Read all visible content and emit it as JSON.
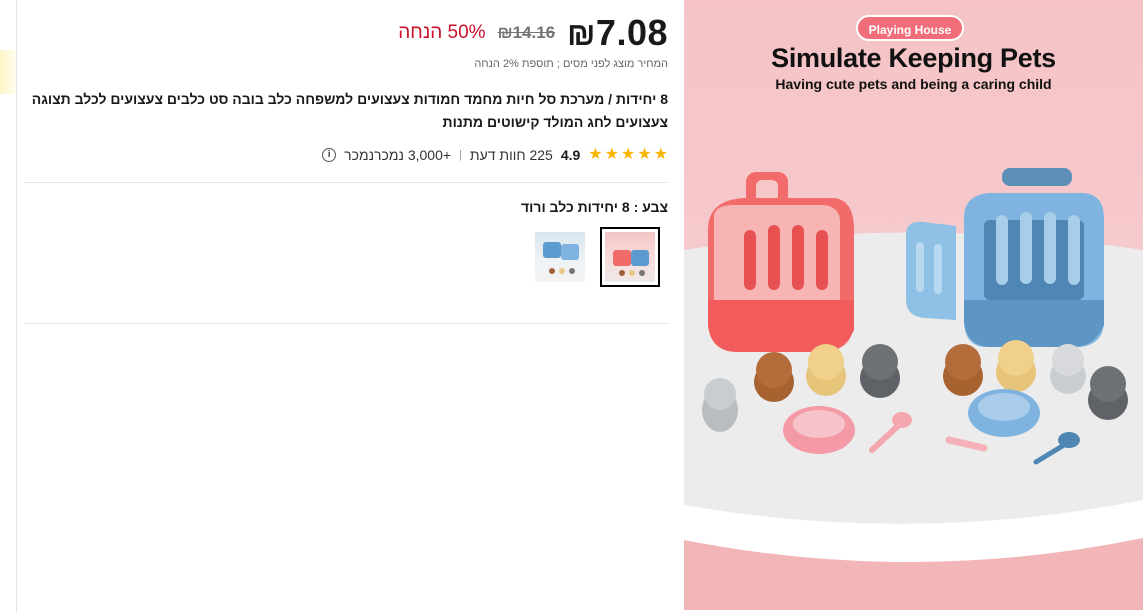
{
  "price": {
    "current": "7.08",
    "currency_symbol": "₪",
    "original": "₪14.16",
    "discount": "50% הנחה",
    "tax_note": "המחיר מוצג לפני מסים ; תוספת 2% הנחה"
  },
  "product": {
    "title": "8 יחידות / מערכת סל חיות מחמד חמודות צעצועים למשפחה כלב בובה סט כלבים צעצועים לכלב תצוגה צעצועים לחג המולד קישוטים מתנות"
  },
  "rating": {
    "value": "4.9",
    "stars": 5,
    "reviews": "225 חוות דעת",
    "separator": "|",
    "sold": "+3,000 נמכרנמכר",
    "info_icon": "info-icon"
  },
  "variant": {
    "label": "צבע : 8 יחידות כלב ורוד",
    "options": [
      {
        "name": "pink",
        "selected": true
      },
      {
        "name": "blue",
        "selected": false
      }
    ]
  },
  "hero": {
    "badge": "Playing House",
    "title": "Simulate Keeping Pets",
    "subtitle": "Having cute pets and being a caring child"
  },
  "colors": {
    "discount_red": "#c90f2a",
    "star_gold": "#f7b500",
    "badge_pink": "#f06d79"
  }
}
